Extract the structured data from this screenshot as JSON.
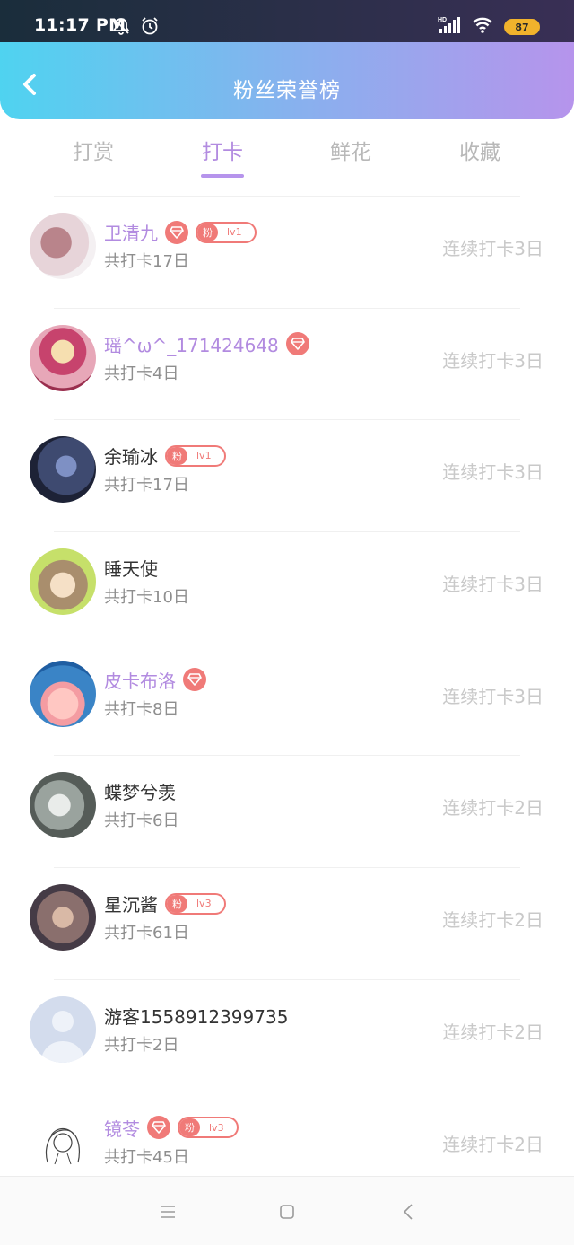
{
  "status": {
    "time": "11:17 PM",
    "battery": "87",
    "network_label": "HD"
  },
  "header": {
    "title": "粉丝荣誉榜"
  },
  "tabs": [
    {
      "label": "打赏",
      "active": false
    },
    {
      "label": "打卡",
      "active": true
    },
    {
      "label": "鲜花",
      "active": false
    },
    {
      "label": "收藏",
      "active": false
    }
  ],
  "rows": [
    {
      "name": "卫清九",
      "vip": true,
      "diamond": true,
      "fan_label": "粉",
      "fan_level": "lv1",
      "total": "共打卡17日",
      "streak": "连续打卡3日"
    },
    {
      "name": "瑶^ω^_171424648",
      "vip": true,
      "diamond": true,
      "fan_label": "",
      "fan_level": "",
      "total": "共打卡4日",
      "streak": "连续打卡3日"
    },
    {
      "name": "余瑜冰",
      "vip": false,
      "diamond": false,
      "fan_label": "粉",
      "fan_level": "lv1",
      "total": "共打卡17日",
      "streak": "连续打卡3日"
    },
    {
      "name": "睡天使",
      "vip": false,
      "diamond": false,
      "fan_label": "",
      "fan_level": "",
      "total": "共打卡10日",
      "streak": "连续打卡3日"
    },
    {
      "name": "皮卡布洛",
      "vip": true,
      "diamond": true,
      "fan_label": "",
      "fan_level": "",
      "total": "共打卡8日",
      "streak": "连续打卡3日"
    },
    {
      "name": "蝶梦兮羡",
      "vip": false,
      "diamond": false,
      "fan_label": "",
      "fan_level": "",
      "total": "共打卡6日",
      "streak": "连续打卡2日"
    },
    {
      "name": "星沉酱",
      "vip": false,
      "diamond": false,
      "fan_label": "粉",
      "fan_level": "lv3",
      "total": "共打卡61日",
      "streak": "连续打卡2日"
    },
    {
      "name": "游客1558912399735",
      "vip": false,
      "diamond": false,
      "fan_label": "",
      "fan_level": "",
      "total": "共打卡2日",
      "streak": "连续打卡2日"
    },
    {
      "name": "镜苓",
      "vip": true,
      "diamond": true,
      "fan_label": "粉",
      "fan_level": "lv3",
      "total": "共打卡45日",
      "streak": "连续打卡2日"
    }
  ],
  "colors": {
    "accent_purple": "#b28be0",
    "badge_red": "#f07a78",
    "gradient_start": "#4fd3f0",
    "gradient_end": "#b694ec"
  }
}
